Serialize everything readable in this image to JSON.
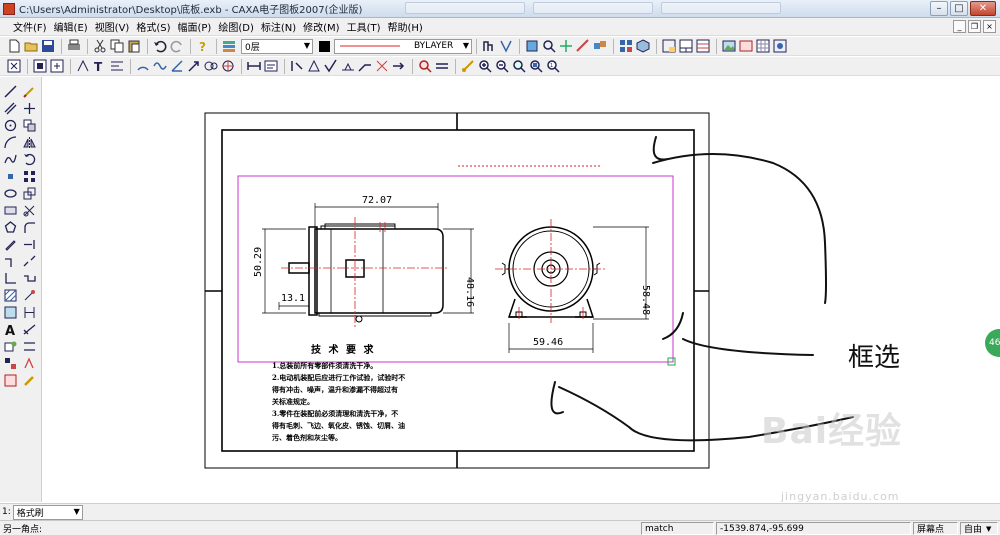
{
  "window": {
    "title": "C:\\Users\\Administrator\\Desktop\\底板.exb - CAXA电子图板2007(企业版)",
    "minimize": "–",
    "maximize": "□",
    "close": "✕"
  },
  "menu": [
    "文件(F)",
    "编辑(E)",
    "视图(V)",
    "格式(S)",
    "幅面(P)",
    "绘图(D)",
    "标注(N)",
    "修改(M)",
    "工具(T)",
    "帮助(H)"
  ],
  "toolbar": {
    "layer_value": "0层",
    "linetype_value": "BYLAYER",
    "color_value": "#000000"
  },
  "drawing": {
    "dimensions": {
      "front_width": "72.07",
      "front_height": "50.29",
      "front_shaft": "13.1",
      "front_body_height": "48.16",
      "side_height": "58.48",
      "side_width": "59.46"
    },
    "notes_title": "技 术 要 求",
    "notes": [
      "1.总装前所有零部件须清洗干净。",
      "2.电动机装配后应进行工作试验，试验时不",
      "  得有冲击、噪声，温升和渗漏不得超过有",
      "  关标准规定。",
      "3.零件在装配前必须清理和清洗干净，不",
      "  得有毛刺、飞边、氧化皮、锈蚀、切屑、油",
      "  污、着色剂和灰尘等。"
    ],
    "annotation": "框选",
    "selection_color": "#cc33cc",
    "center_line_color": "#dd2222"
  },
  "overlay": {
    "watermark": "Bai经验",
    "watermark_url": "jingyan.baidu.com",
    "badge": "46"
  },
  "command": {
    "index": "1:",
    "select_value": "格式刷"
  },
  "status": {
    "prompt": "另一角点:",
    "mode": "match",
    "coords": "-1539.874,-95.699",
    "snap": "屏幕点",
    "free": "自由"
  }
}
